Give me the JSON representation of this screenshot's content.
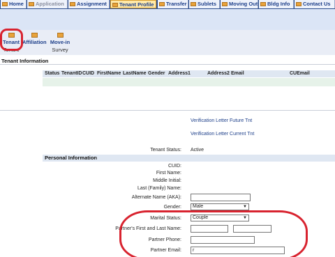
{
  "top_tabs": [
    "Home",
    "Application",
    "Assignment",
    "Tenant Profile",
    "Transfer",
    "Sublets",
    "Moving Out",
    "Bldg Info",
    "Contact Us"
  ],
  "sub_tabs": [
    {
      "label": "Tenant",
      "sub": "Tenant"
    },
    {
      "label": "Affiliation",
      "sub": ""
    },
    {
      "label": "Move-in",
      "sub": "Survey"
    }
  ],
  "section_title": "Tenant Information",
  "table_headers": [
    "Status",
    "TenantID",
    "CUID",
    "FirstName",
    "LastName",
    "Gender",
    "Address1",
    "Address2",
    "Email",
    "CUEmail"
  ],
  "links": {
    "future": "Verification Letter Future Tnt",
    "current": "Verification Letter Current Tnt"
  },
  "tenant_status": {
    "label": "Tenant Status:",
    "value": "Active"
  },
  "personal_info_title": "Personal Information",
  "fields": {
    "cuid": "CUID:",
    "first_name": "First Name:",
    "middle_initial": "Middle Initial:",
    "last_name": "Last (Family) Name:",
    "alternate_name": "Alternate Name (AKA):",
    "gender": "Gender:",
    "marital_status": "Marital Status:",
    "partner_name": "Partner's First and Last Name:",
    "partner_phone": "Partner Phone:",
    "partner_email": "Partner Email:"
  },
  "values": {
    "gender": "Male",
    "marital_status": "Couple",
    "partner_email": "r"
  },
  "colors": {
    "nav": "#2a4c8c",
    "highlight": "#d8232f",
    "tab_text": "#1d3f8a"
  }
}
